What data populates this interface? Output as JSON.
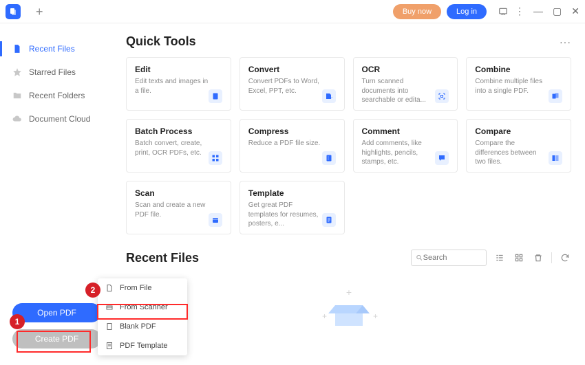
{
  "titlebar": {
    "buy_now": "Buy now",
    "log_in": "Log in"
  },
  "sidebar": {
    "items": [
      {
        "label": "Recent Files",
        "active": true
      },
      {
        "label": "Starred Files",
        "active": false
      },
      {
        "label": "Recent Folders",
        "active": false
      },
      {
        "label": "Document Cloud",
        "active": false
      }
    ],
    "open_pdf": "Open PDF",
    "create_pdf": "Create PDF"
  },
  "quick_tools": {
    "title": "Quick Tools",
    "cards": [
      {
        "title": "Edit",
        "desc": "Edit texts and images in a file."
      },
      {
        "title": "Convert",
        "desc": "Convert PDFs to Word, Excel, PPT, etc."
      },
      {
        "title": "OCR",
        "desc": "Turn scanned documents into searchable or edita..."
      },
      {
        "title": "Combine",
        "desc": "Combine multiple files into a single PDF."
      },
      {
        "title": "Batch Process",
        "desc": "Batch convert, create, print, OCR PDFs, etc."
      },
      {
        "title": "Compress",
        "desc": "Reduce a PDF file size."
      },
      {
        "title": "Comment",
        "desc": "Add comments, like highlights, pencils, stamps, etc."
      },
      {
        "title": "Compare",
        "desc": "Compare the differences between two files."
      },
      {
        "title": "Scan",
        "desc": "Scan and create a new PDF file."
      },
      {
        "title": "Template",
        "desc": "Get great PDF templates for resumes, posters, e..."
      }
    ]
  },
  "recent_files": {
    "title": "Recent Files",
    "search_placeholder": "Search"
  },
  "create_menu": {
    "items": [
      {
        "label": "From File"
      },
      {
        "label": "From Scanner"
      },
      {
        "label": "Blank PDF"
      },
      {
        "label": "PDF Template"
      }
    ]
  },
  "annotations": {
    "n1": "1",
    "n2": "2"
  },
  "colors": {
    "accent": "#2f6bff",
    "buy": "#f0a06a",
    "annot": "#ff2a2a"
  }
}
